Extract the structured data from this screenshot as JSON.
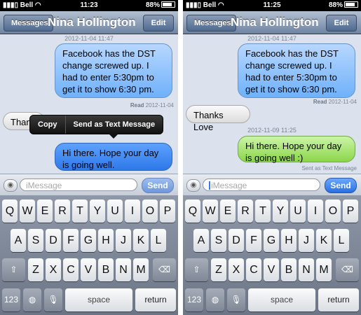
{
  "status": {
    "carrier": "Bell",
    "battery": "88%"
  },
  "left": {
    "time": "11:23",
    "nav": {
      "back": "Messages",
      "title": "Nina Hollington",
      "edit": "Edit"
    },
    "top_timestamp": "2012-11-04 11:47",
    "msg1": "Facebook has the DST change screwed up. I had to enter 5:30pm to get it to show 6:30 pm.",
    "read_label": "Read",
    "read_date": "2012-11-04",
    "partial_bubble": "Thank",
    "popup": {
      "copy": "Copy",
      "send_as_text": "Send as Text Message"
    },
    "msg2": "Hi there. Hope your day is going well.",
    "input": {
      "placeholder": "iMessage",
      "send": "Send"
    }
  },
  "right": {
    "time": "11:25",
    "nav": {
      "back": "Messages",
      "title": "Nina Hollington",
      "edit": "Edit"
    },
    "top_timestamp": "2012-11-04 11:47",
    "msg1": "Facebook has the DST change screwed up. I had to enter 5:30pm to get it to show 6:30 pm.",
    "read_label": "Read",
    "read_date": "2012-11-04",
    "reply": "Thanks Love",
    "timestamp2": "2012-11-09 11:25",
    "msg2": "Hi there. Hope your day is going well :)",
    "sent_as_text": "Sent as Text Message",
    "input": {
      "placeholder": "iMessage",
      "send": "Send"
    }
  },
  "keyboard": {
    "row1": [
      "Q",
      "W",
      "E",
      "R",
      "T",
      "Y",
      "U",
      "I",
      "O",
      "P"
    ],
    "row2": [
      "A",
      "S",
      "D",
      "F",
      "G",
      "H",
      "J",
      "K",
      "L"
    ],
    "row3": [
      "Z",
      "X",
      "C",
      "V",
      "B",
      "N",
      "M"
    ],
    "numbers": "123",
    "space": "space",
    "return": "return",
    "shift_icon": "shift-arrow-icon",
    "delete_icon": "backspace-icon",
    "globe_icon": "globe-icon",
    "mic_icon": "microphone-icon"
  },
  "colors": {
    "blue_bubble": "#7db8fb",
    "green_bubble": "#94d957",
    "nav_bar": "#6e84a2"
  }
}
